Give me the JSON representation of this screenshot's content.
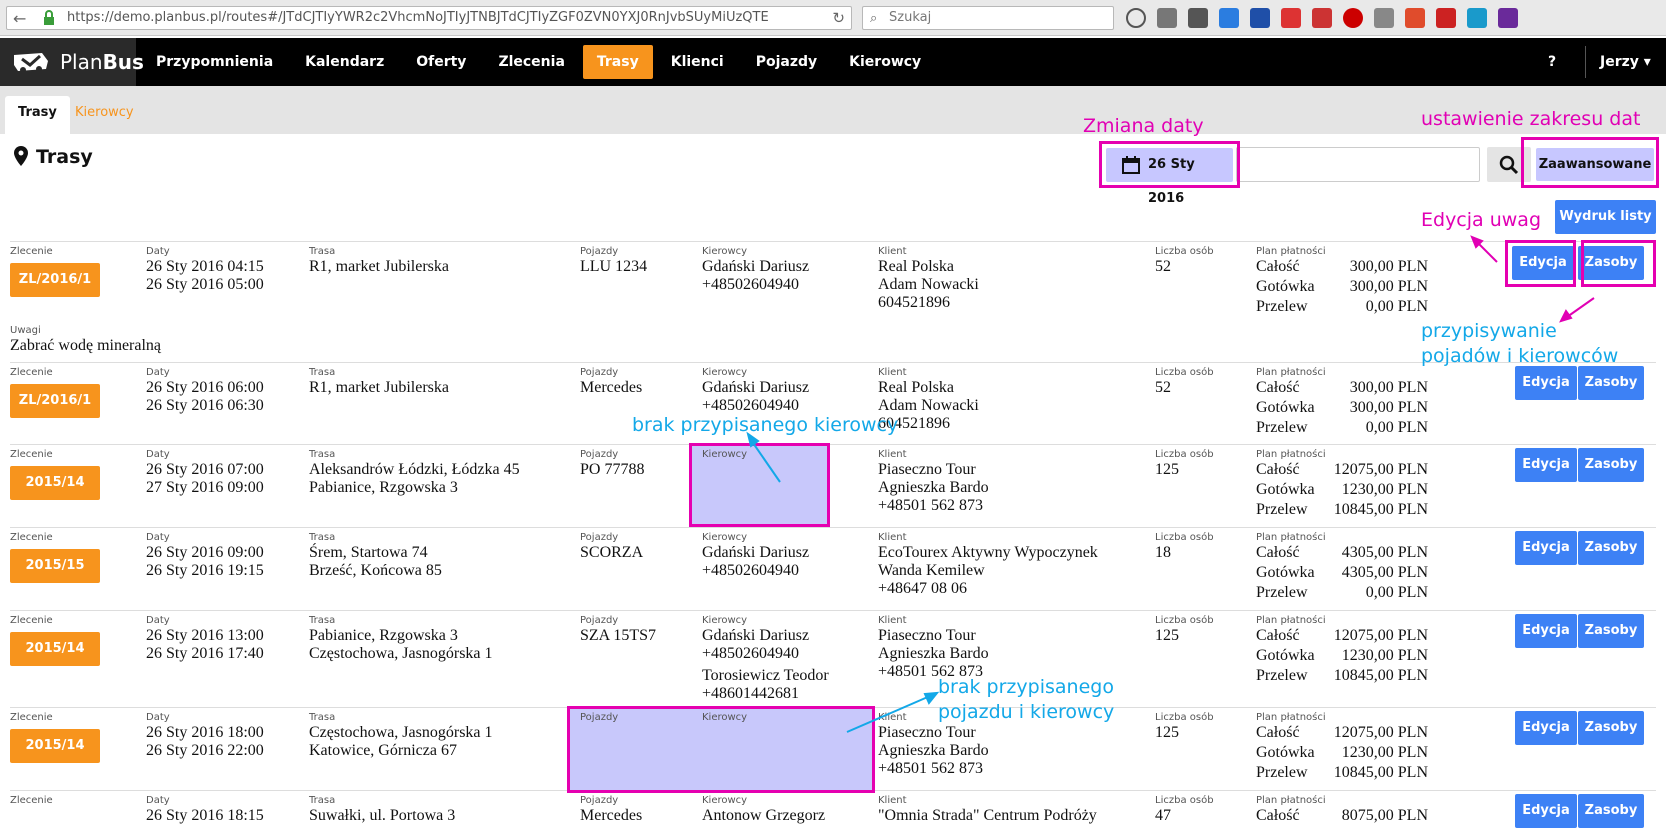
{
  "browser": {
    "url": "https://demo.planbus.pl/routes#/JTdCJTIyYWR2c2VhcmNoJTIyJTNBJTdCJTIyZGF0ZVN0YXJ0RnJvbSUyMiUzQTE",
    "search_placeholder": "Szukaj"
  },
  "navbar": {
    "brand_plan": "Plan",
    "brand_bus": "Bus",
    "items": [
      "Przypomnienia",
      "Kalendarz",
      "Oferty",
      "Zlecenia",
      "Trasy",
      "Klienci",
      "Pojazdy",
      "Kierowcy"
    ],
    "help": "?",
    "user": "Jerzy ▾"
  },
  "subtabs": [
    "Trasy",
    "Kierowcy"
  ],
  "page": {
    "title": "Trasy",
    "date_button": "26 Sty 2016",
    "advanced_button": "Zaawansowane",
    "print_button": "Wydruk listy"
  },
  "labels": {
    "order": "Zlecenie",
    "dates": "Daty",
    "route": "Trasa",
    "vehicles": "Pojazdy",
    "drivers": "Kierowcy",
    "client": "Klient",
    "persons": "Liczba osób",
    "payment_plan": "Plan płatności",
    "total": "Całość",
    "cash": "Gotówka",
    "transfer": "Przelew",
    "notes": "Uwagi",
    "edit": "Edycja",
    "resources": "Zasoby"
  },
  "rows": [
    {
      "order": "ZL/2016/1",
      "dates": [
        "26 Sty 2016 04:15",
        "26 Sty 2016 05:00"
      ],
      "route": [
        "R1, market Jubilerska"
      ],
      "vehicles": [
        "LLU 1234"
      ],
      "drivers": [
        "Gdański Dariusz",
        "+48502604940"
      ],
      "client": [
        "Real Polska",
        "Adam Nowacki",
        "604521896"
      ],
      "persons": "52",
      "total": "300,00 PLN",
      "cash": "300,00 PLN",
      "transfer": "0,00 PLN",
      "notes": "Zabrać wodę mineralną"
    },
    {
      "order": "ZL/2016/1",
      "dates": [
        "26 Sty 2016 06:00",
        "26 Sty 2016 06:30"
      ],
      "route": [
        "R1, market Jubilerska"
      ],
      "vehicles": [
        "Mercedes"
      ],
      "drivers": [
        "Gdański Dariusz",
        "+48502604940"
      ],
      "client": [
        "Real Polska",
        "Adam Nowacki",
        "604521896"
      ],
      "persons": "52",
      "total": "300,00 PLN",
      "cash": "300,00 PLN",
      "transfer": "0,00 PLN"
    },
    {
      "order": "2015/14",
      "dates": [
        "26 Sty 2016 07:00",
        "27 Sty 2016 09:00"
      ],
      "route": [
        "Aleksandrów Łódzki, Łódzka 45",
        "Pabianice, Rzgowska 3"
      ],
      "vehicles": [
        "PO 77788"
      ],
      "drivers": [],
      "client": [
        "Piaseczno Tour",
        "Agnieszka Bardo",
        "+48501 562 873"
      ],
      "persons": "125",
      "total": "12075,00 PLN",
      "cash": "1230,00 PLN",
      "transfer": "10845,00 PLN"
    },
    {
      "order": "2015/15",
      "dates": [
        "26 Sty 2016 09:00",
        "26 Sty 2016 19:15"
      ],
      "route": [
        "Śrem, Startowa 74",
        "Brześć, Końcowa 85"
      ],
      "vehicles": [
        "SCORZA"
      ],
      "drivers": [
        "Gdański Dariusz",
        "+48502604940"
      ],
      "client": [
        "EcoTourex Aktywny Wypoczynek",
        "Wanda Kemilew",
        "+48647 08 06"
      ],
      "persons": "18",
      "total": "4305,00 PLN",
      "cash": "4305,00 PLN",
      "transfer": "0,00 PLN"
    },
    {
      "order": "2015/14",
      "dates": [
        "26 Sty 2016 13:00",
        "26 Sty 2016 17:40"
      ],
      "route": [
        "Pabianice, Rzgowska 3",
        "Częstochowa, Jasnogórska 1"
      ],
      "vehicles": [
        "SZA 15TS7"
      ],
      "drivers": [
        "Gdański Dariusz",
        "+48502604940",
        "Torosiewicz Teodor",
        "+48601442681"
      ],
      "client": [
        "Piaseczno Tour",
        "Agnieszka Bardo",
        "+48501 562 873"
      ],
      "persons": "125",
      "total": "12075,00 PLN",
      "cash": "1230,00 PLN",
      "transfer": "10845,00 PLN"
    },
    {
      "order": "2015/14",
      "dates": [
        "26 Sty 2016 18:00",
        "26 Sty 2016 22:00"
      ],
      "route": [
        "Częstochowa, Jasnogórska 1",
        "Katowice, Górnicza 67"
      ],
      "vehicles": [],
      "drivers": [],
      "client": [
        "Piaseczno Tour",
        "Agnieszka Bardo",
        "+48501 562 873"
      ],
      "persons": "125",
      "total": "12075,00 PLN",
      "cash": "1230,00 PLN",
      "transfer": "10845,00 PLN"
    },
    {
      "order": "",
      "dates": [
        "26 Sty 2016 18:15"
      ],
      "route": [
        "Suwałki, ul. Portowa 3"
      ],
      "vehicles": [
        "Mercedes"
      ],
      "drivers": [
        "Antonow Grzegorz"
      ],
      "client": [
        "\"Omnia Strada\" Centrum Podróży"
      ],
      "persons": "47",
      "total": "8075,00 PLN",
      "cash": "",
      "transfer": ""
    }
  ],
  "annotations": {
    "date_change": "Zmiana daty",
    "date_range": "ustawienie zakresu dat",
    "notes_edit": "Edycja uwag",
    "assign": [
      "przypisywanie",
      "pojadów i kierowców"
    ],
    "no_driver": "brak przypisanego kierowcy",
    "no_vehicle_driver": [
      "brak przypisanego",
      "pojazdu i kierowcy"
    ]
  },
  "colors": {
    "accent_orange": "#f7941d",
    "button_blue": "#3d81f5",
    "annotation_pink": "#e100b4",
    "annotation_blue": "#13a8e8",
    "highlight": "#c8c8fb"
  }
}
